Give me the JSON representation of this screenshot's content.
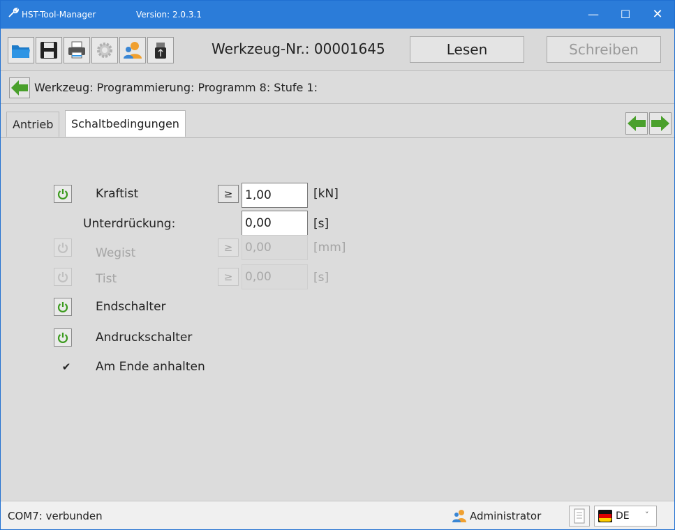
{
  "window": {
    "app_name": "HST-Tool-Manager",
    "version": "Version: 2.0.3.1",
    "controls": {
      "minimize": "—",
      "maximize": "☐",
      "close": "✕"
    }
  },
  "toolbar": {
    "icons": [
      "folder-open-icon",
      "save-icon",
      "print-icon",
      "settings-icon",
      "user-icon",
      "usb-icon"
    ],
    "werkzeug_nr": "Werkzeug-Nr.: 00001645",
    "read_label": "Lesen",
    "write_label": "Schreiben"
  },
  "breadcrumb": {
    "text": "Werkzeug: Programmierung: Programm 8: Stufe 1:"
  },
  "tabs": [
    {
      "label": "Antrieb",
      "active": false
    },
    {
      "label": "Schaltbedingungen",
      "active": true
    }
  ],
  "conditions": {
    "kraftist": {
      "label": "Kraftist",
      "op": "≥",
      "value": "1,00",
      "unit": "[kN]",
      "enabled": true
    },
    "unterdrueckung": {
      "label": "Unterdrückung:",
      "value": "0,00",
      "unit": "[s]"
    },
    "wegist": {
      "label": "Wegist",
      "op": "≥",
      "value": "0,00",
      "unit": "[mm]",
      "enabled": false
    },
    "tist": {
      "label": "Tist",
      "op": "≥",
      "value": "0,00",
      "unit": "[s]",
      "enabled": false
    },
    "endschalter": {
      "label": "Endschalter",
      "enabled": true
    },
    "andruckschalter": {
      "label": "Andruckschalter",
      "enabled": true
    },
    "am_ende": {
      "label": "Am Ende anhalten",
      "checked": true,
      "mark": "✔"
    }
  },
  "status": {
    "connection": "COM7: verbunden",
    "user": "Administrator",
    "language": "DE",
    "chevron": "˅"
  },
  "colors": {
    "titlebar": "#2b7cd9",
    "power_on": "#3a9a1c",
    "power_off": "#c0c0c0",
    "arrow_green": "#4aa02c"
  }
}
